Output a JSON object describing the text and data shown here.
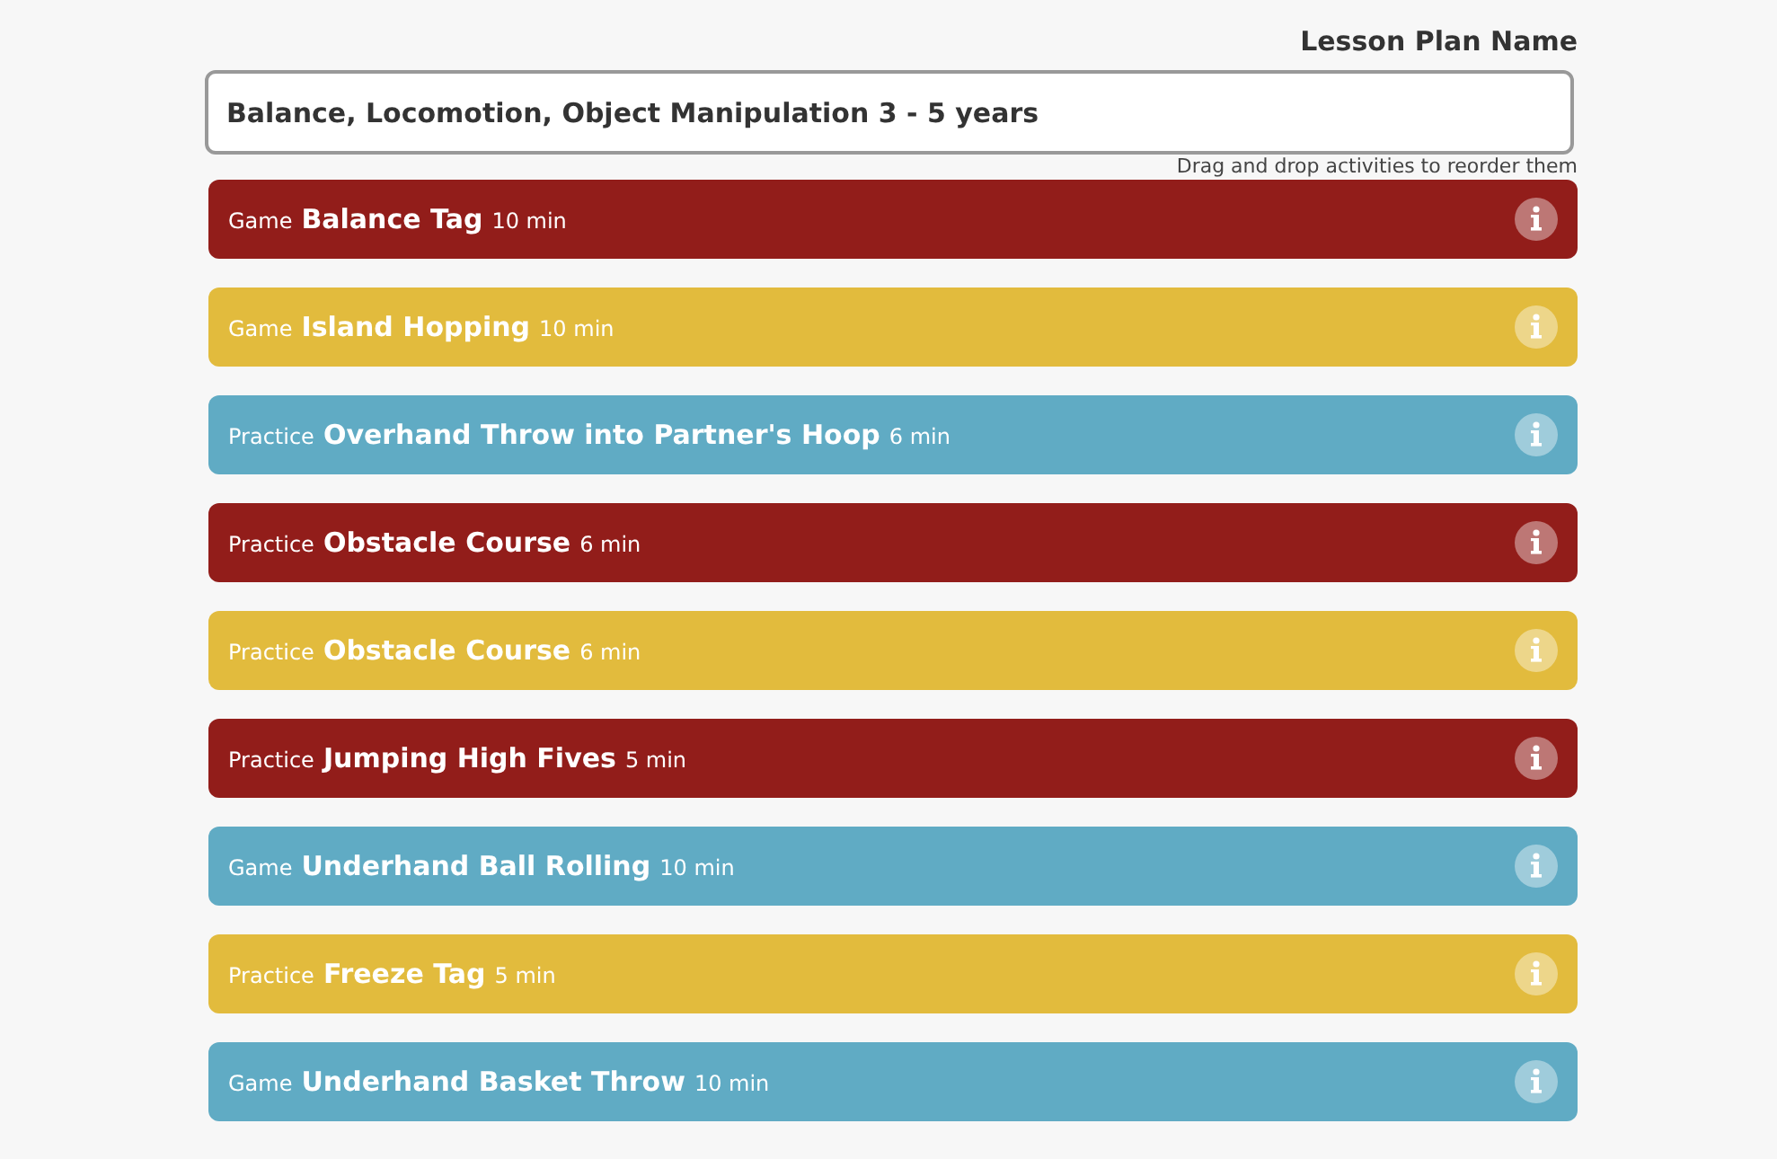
{
  "lesson_plan_name": {
    "label": "Lesson Plan Name",
    "value": "Balance, Locomotion, Object Manipulation 3 - 5 years"
  },
  "hint": "Drag and drop activities to reorder them",
  "activities": [
    {
      "type": "Game",
      "name": "Balance Tag",
      "duration": "10 min",
      "color": "#921d1a"
    },
    {
      "type": "Game",
      "name": "Island Hopping",
      "duration": "10 min",
      "color": "#e2bb3d"
    },
    {
      "type": "Practice",
      "name": "Overhand Throw into Partner's Hoop",
      "duration": "6 min",
      "color": "#60abc4"
    },
    {
      "type": "Practice",
      "name": "Obstacle Course",
      "duration": "6 min",
      "color": "#921d1a"
    },
    {
      "type": "Practice",
      "name": "Obstacle Course",
      "duration": "6 min",
      "color": "#e2bb3d"
    },
    {
      "type": "Practice",
      "name": "Jumping High Fives",
      "duration": "5 min",
      "color": "#921d1a"
    },
    {
      "type": "Game",
      "name": "Underhand Ball Rolling",
      "duration": "10 min",
      "color": "#60abc4"
    },
    {
      "type": "Practice",
      "name": "Freeze Tag",
      "duration": "5 min",
      "color": "#e2bb3d"
    },
    {
      "type": "Game",
      "name": "Underhand Basket Throw",
      "duration": "10 min",
      "color": "#60abc4"
    }
  ]
}
